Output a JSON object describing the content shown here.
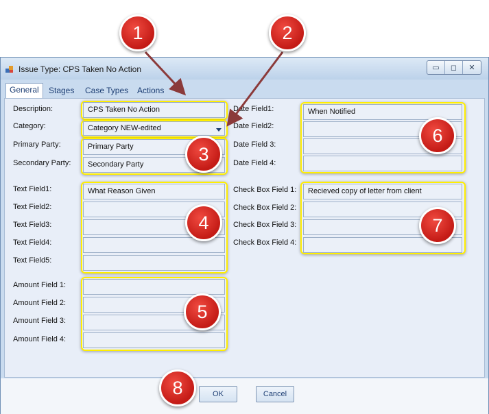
{
  "window": {
    "title": "Issue Type: CPS Taken No Action",
    "controls": {
      "minimize": "▭",
      "restore": "◻",
      "close": "✕"
    }
  },
  "tabs": [
    {
      "label": "General",
      "active": true
    },
    {
      "label": "Stages"
    },
    {
      "label": "Case Types"
    },
    {
      "label": "Actions"
    }
  ],
  "left_fields": {
    "description_label": "Description:",
    "description_value": "CPS Taken No Action",
    "category_label": "Category:",
    "category_value": "Category NEW-edited",
    "primary_party_label": "Primary Party:",
    "primary_party_value": "Primary Party",
    "secondary_party_label": "Secondary Party:",
    "secondary_party_value": "Secondary Party",
    "text_fields": [
      {
        "label": "Text Field1:",
        "value": "What Reason Given"
      },
      {
        "label": "Text Field2:",
        "value": ""
      },
      {
        "label": "Text Field3:",
        "value": ""
      },
      {
        "label": "Text Field4:",
        "value": ""
      },
      {
        "label": "Text Field5:",
        "value": ""
      }
    ],
    "amount_fields": [
      {
        "label": "Amount Field 1:",
        "value": ""
      },
      {
        "label": "Amount Field 2:",
        "value": ""
      },
      {
        "label": "Amount Field 3:",
        "value": ""
      },
      {
        "label": "Amount Field 4:",
        "value": ""
      }
    ]
  },
  "right_fields": {
    "date_fields": [
      {
        "label": "Date Field1:",
        "value": "When Notified"
      },
      {
        "label": "Date Field2:",
        "value": ""
      },
      {
        "label": "Date Field 3:",
        "value": ""
      },
      {
        "label": "Date Field 4:",
        "value": ""
      }
    ],
    "check_box_fields": [
      {
        "label": "Check Box Field 1:",
        "value": "Recieved copy of letter from client"
      },
      {
        "label": "Check Box Field 2:",
        "value": ""
      },
      {
        "label": "Check Box Field 3:",
        "value": ""
      },
      {
        "label": "Check Box Field 4:",
        "value": ""
      }
    ]
  },
  "buttons": {
    "ok": "OK",
    "cancel": "Cancel"
  },
  "callouts": [
    "1",
    "2",
    "3",
    "4",
    "5",
    "6",
    "7",
    "8"
  ],
  "colors": {
    "highlight": "#ffee00",
    "callout": "#d42a22",
    "arrow": "#8b3a3a"
  }
}
